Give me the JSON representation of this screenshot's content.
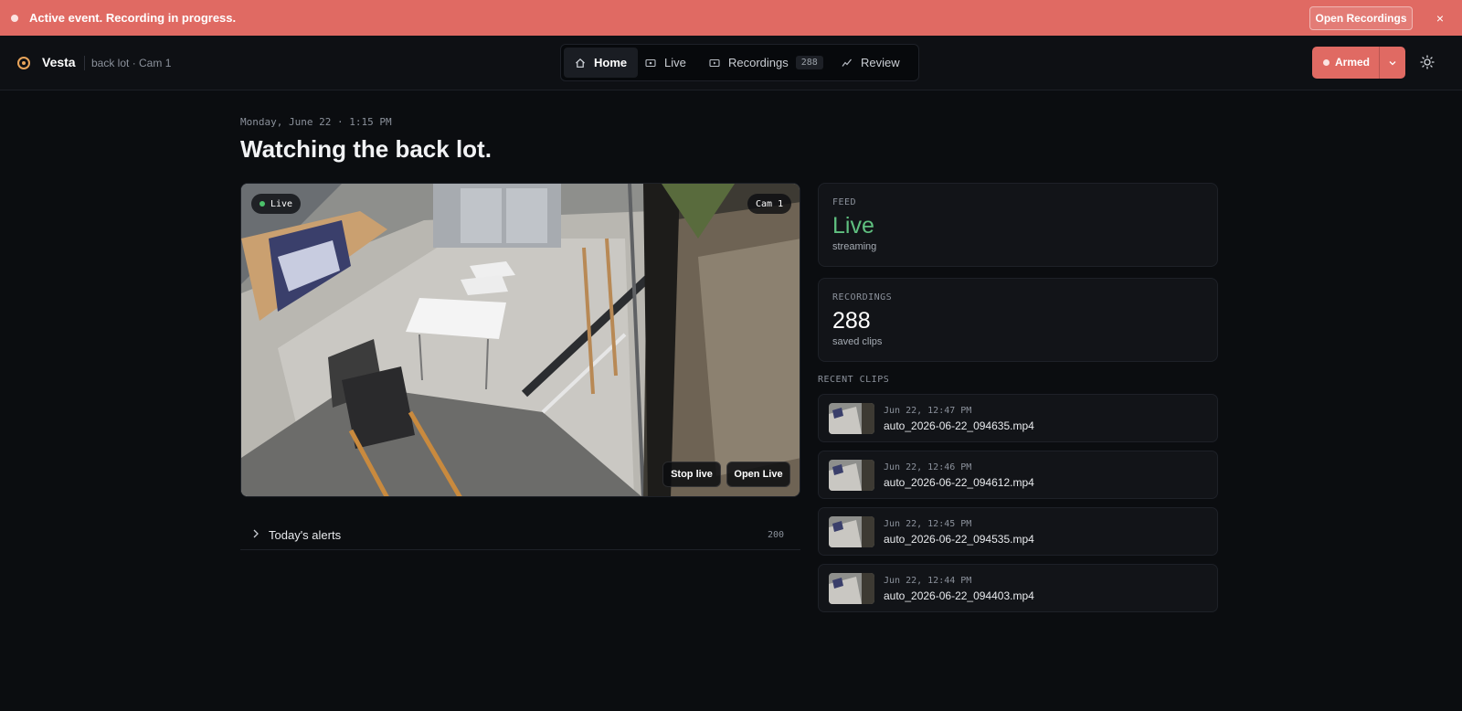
{
  "banner": {
    "message": "Active event. Recording in progress.",
    "open_label": "Open Recordings",
    "close_label": "×"
  },
  "header": {
    "brand": "Vesta",
    "context": "back lot · Cam 1",
    "nav": [
      {
        "label": "Home",
        "icon": "home-icon",
        "active": true
      },
      {
        "label": "Live",
        "icon": "monitor-icon",
        "active": false
      },
      {
        "label": "Recordings",
        "icon": "play-box-icon",
        "badge": "288",
        "active": false
      },
      {
        "label": "Review",
        "icon": "activity-icon",
        "active": false
      }
    ],
    "armed_label": "Armed",
    "accent_color": "#e06a63"
  },
  "main": {
    "datetime": "Monday, June 22 · 1:15 PM",
    "title": "Watching the back lot.",
    "video": {
      "live_badge": "Live",
      "cam_badge": "Cam 1",
      "stop_label": "Stop live",
      "open_label": "Open Live"
    },
    "alerts": {
      "label": "Today's alerts",
      "count": "200"
    }
  },
  "side": {
    "feed": {
      "key": "FEED",
      "value": "Live",
      "sub": "streaming",
      "value_color": "#5fbf7f"
    },
    "recordings": {
      "key": "RECORDINGS",
      "value": "288",
      "sub": "saved clips"
    },
    "recent_label": "RECENT CLIPS",
    "clips": [
      {
        "time": "Jun 22, 12:47 PM",
        "file": "auto_2026-06-22_094635.mp4"
      },
      {
        "time": "Jun 22, 12:46 PM",
        "file": "auto_2026-06-22_094612.mp4"
      },
      {
        "time": "Jun 22, 12:45 PM",
        "file": "auto_2026-06-22_094535.mp4"
      },
      {
        "time": "Jun 22, 12:44 PM",
        "file": "auto_2026-06-22_094403.mp4"
      }
    ]
  }
}
